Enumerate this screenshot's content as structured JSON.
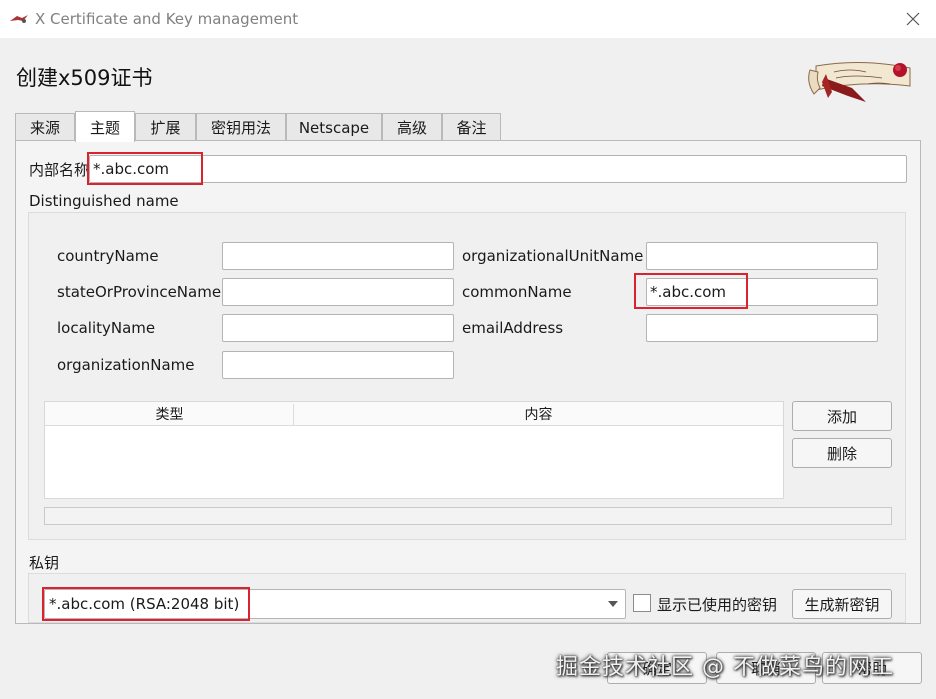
{
  "window": {
    "title": "X Certificate and Key management"
  },
  "heading": "创建x509证书",
  "tabs": [
    {
      "label": "来源",
      "active": false
    },
    {
      "label": "主题",
      "active": true
    },
    {
      "label": "扩展",
      "active": false
    },
    {
      "label": "密钥用法",
      "active": false
    },
    {
      "label": "Netscape",
      "active": false
    },
    {
      "label": "高级",
      "active": false
    },
    {
      "label": "备注",
      "active": false
    }
  ],
  "subject": {
    "internal_name_label": "内部名称",
    "internal_name_value": "*.abc.com",
    "dn_section_label": "Distinguished name",
    "fields": {
      "countryName": {
        "label": "countryName",
        "value": ""
      },
      "stateOrProvinceName": {
        "label": "stateOrProvinceName",
        "value": ""
      },
      "localityName": {
        "label": "localityName",
        "value": ""
      },
      "organizationName": {
        "label": "organizationName",
        "value": ""
      },
      "organizationalUnitName": {
        "label": "organizationalUnitName",
        "value": ""
      },
      "commonName": {
        "label": "commonName",
        "value": "*.abc.com"
      },
      "emailAddress": {
        "label": "emailAddress",
        "value": ""
      }
    },
    "table": {
      "columns": [
        "类型",
        "内容"
      ],
      "rows": []
    },
    "add_button": "添加",
    "delete_button": "删除"
  },
  "private_key": {
    "section_label": "私钥",
    "selected": "*.abc.com (RSA:2048 bit)",
    "show_used_label": "显示已使用的密钥",
    "show_used_checked": false,
    "generate_button": "生成新密钥"
  },
  "footer": {
    "ok_button": "确定",
    "cancel_button": "取消",
    "help_button": "帮助"
  },
  "watermark": "掘金技术社区 @ 不做菜鸟的网工",
  "colors": {
    "highlight": "#d9232e",
    "background": "#f0f0f0"
  }
}
